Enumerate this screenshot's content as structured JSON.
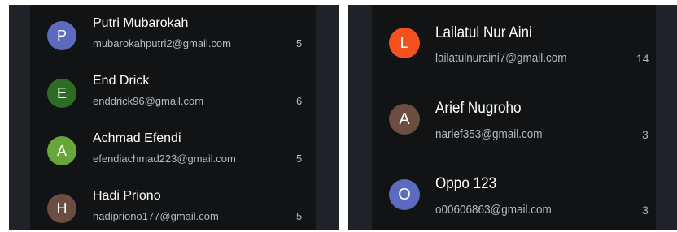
{
  "left_panel": {
    "contacts": [
      {
        "initial": "P",
        "name": "Putri Mubarokah",
        "email": "mubarokahputri2@gmail.com",
        "count": "5",
        "avatar_color": "#5c6bc0"
      },
      {
        "initial": "E",
        "name": "End Drick",
        "email": "enddrick96@gmail.com",
        "count": "6",
        "avatar_color": "#2e6b24"
      },
      {
        "initial": "A",
        "name": "Achmad Efendi",
        "email": "efendiachmad223@gmail.com",
        "count": "5",
        "avatar_color": "#66a63a"
      },
      {
        "initial": "H",
        "name": "Hadi Priono",
        "email": "hadipriono177@gmail.com",
        "count": "5",
        "avatar_color": "#6d4c41"
      }
    ]
  },
  "right_panel": {
    "contacts": [
      {
        "initial": "L",
        "name": "Lailatul Nur Aini",
        "email": "lailatulnuraini7@gmail.com",
        "count": "14",
        "avatar_color": "#f4511e"
      },
      {
        "initial": "A",
        "name": "Arief Nugroho",
        "email": "narief353@gmail.com",
        "count": "3",
        "avatar_color": "#6d4c41"
      },
      {
        "initial": "O",
        "name": "Oppo 123",
        "email": "o00606863@gmail.com",
        "count": "3",
        "avatar_color": "#5c6bc0"
      }
    ]
  }
}
